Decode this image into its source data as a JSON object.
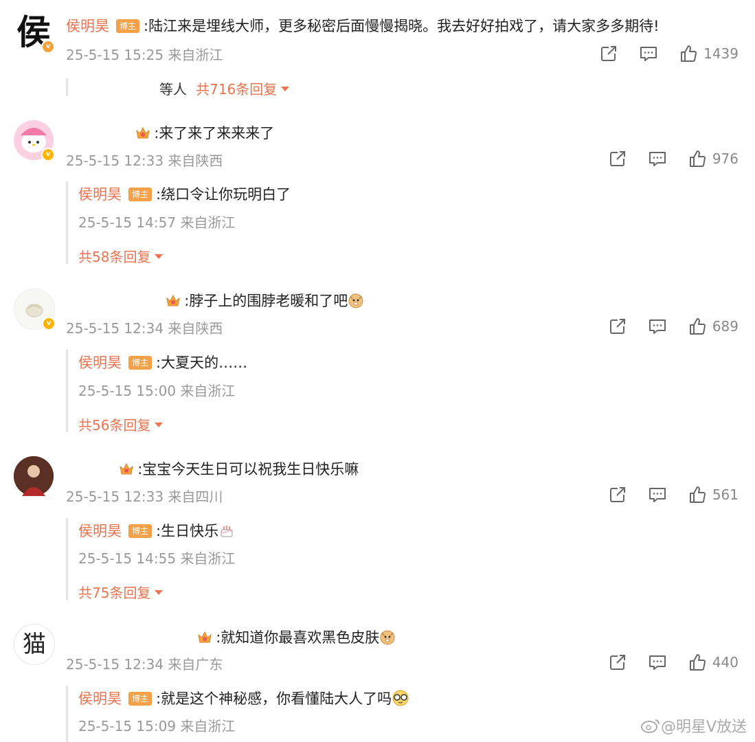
{
  "comments": [
    {
      "user": "侯明昊",
      "badge": "博主",
      "text": ":陆江来是埋线大师，更多秘密后面慢慢揭晓。我去好好拍戏了，请大家多多期待!",
      "time": "25-5-15 15:25 来自浙江",
      "likes": "1439",
      "replies_prefix": "等人",
      "more": "共716条回复",
      "avatar_char": "侯"
    },
    {
      "text": ":来了来了来来来了",
      "time": "25-5-15 12:33 来自陕西",
      "likes": "976",
      "reply": {
        "user": "侯明昊",
        "badge": "博主",
        "text": ":绕口令让你玩明白了",
        "time": "25-5-15 14:57 来自浙江"
      },
      "more": "共58条回复"
    },
    {
      "text": ":脖子上的围脖老暖和了吧",
      "time": "25-5-15 12:34 来自陕西",
      "likes": "689",
      "reply": {
        "user": "侯明昊",
        "badge": "博主",
        "text": ":大夏天的……",
        "time": "25-5-15 15:00 来自浙江"
      },
      "more": "共56条回复"
    },
    {
      "text": ":宝宝今天生日可以祝我生日快乐嘛",
      "time": "25-5-15 12:33 来自四川",
      "likes": "561",
      "reply": {
        "user": "侯明昊",
        "badge": "博主",
        "text": ":生日快乐",
        "time": "25-5-15 14:55 来自浙江"
      },
      "more": "共75条回复"
    },
    {
      "text": ":就知道你最喜欢黑色皮肤",
      "time": "25-5-15 12:34 来自广东",
      "likes": "440",
      "avatar_char": "猫",
      "reply": {
        "user": "侯明昊",
        "badge": "博主",
        "text": ":就是这个神秘感，你看懂陆大人了吗",
        "time": "25-5-15 15:09 来自浙江"
      }
    }
  ],
  "watermark": "@明星V放送",
  "icons": {
    "share": "share-icon",
    "comment": "comment-icon",
    "like": "thumbs-up-icon",
    "crown": "crown-badge-icon",
    "emoji_doge": "doge-emoji",
    "emoji_cake": "cake-emoji",
    "emoji_glasses": "glasses-emoji"
  },
  "colors": {
    "username": "#eb7350",
    "badge": "#f6a04a",
    "meta": "#999999"
  }
}
